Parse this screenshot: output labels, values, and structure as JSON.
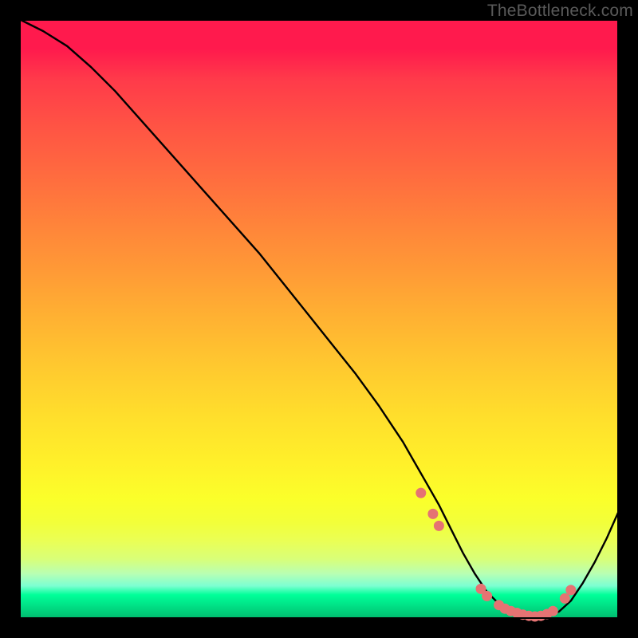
{
  "watermark": "TheBottleneck.com",
  "colors": {
    "curve": "#000000",
    "marker_fill": "#e57373",
    "marker_stroke": "#cc5c5c",
    "green_band": "#00e689"
  },
  "chart_data": {
    "type": "line",
    "title": "",
    "xlabel": "",
    "ylabel": "",
    "xlim": [
      0,
      100
    ],
    "ylim": [
      0,
      100
    ],
    "x": [
      0,
      4,
      8,
      12,
      16,
      20,
      24,
      28,
      32,
      36,
      40,
      44,
      48,
      52,
      56,
      60,
      62,
      64,
      66,
      68,
      70,
      72,
      74,
      76,
      78,
      80,
      82,
      84,
      86,
      88,
      90,
      92,
      94,
      96,
      98,
      100
    ],
    "values": [
      100,
      98,
      95.5,
      92,
      88,
      83.5,
      79,
      74.5,
      70,
      65.5,
      61,
      56,
      51,
      46,
      41,
      35.5,
      32.5,
      29.5,
      26,
      22.5,
      19,
      15,
      11,
      7.5,
      4.5,
      2.5,
      1.2,
      0.6,
      0.3,
      0.5,
      1.2,
      3,
      6,
      9.5,
      13.5,
      18
    ],
    "markers": [
      {
        "x": 67,
        "y": 21
      },
      {
        "x": 69,
        "y": 17.5
      },
      {
        "x": 70,
        "y": 15.5
      },
      {
        "x": 77,
        "y": 5
      },
      {
        "x": 78,
        "y": 3.8
      },
      {
        "x": 80,
        "y": 2.3
      },
      {
        "x": 81,
        "y": 1.7
      },
      {
        "x": 82,
        "y": 1.3
      },
      {
        "x": 83,
        "y": 1.0
      },
      {
        "x": 84,
        "y": 0.7
      },
      {
        "x": 85,
        "y": 0.5
      },
      {
        "x": 86,
        "y": 0.4
      },
      {
        "x": 87,
        "y": 0.5
      },
      {
        "x": 88,
        "y": 0.8
      },
      {
        "x": 89,
        "y": 1.3
      },
      {
        "x": 91,
        "y": 3.4
      },
      {
        "x": 92,
        "y": 4.8
      }
    ]
  }
}
